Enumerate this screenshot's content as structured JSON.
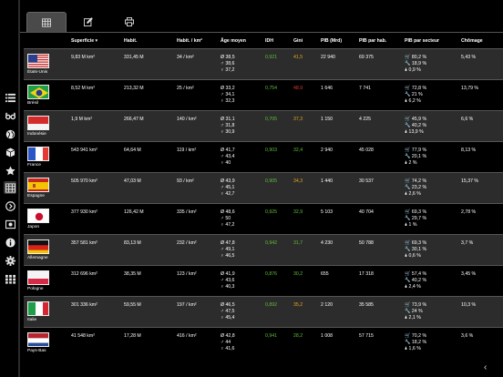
{
  "tabs": [
    {
      "name": "grid-tab",
      "icon": "table-icon",
      "active": true
    },
    {
      "name": "edit-tab",
      "icon": "edit-icon",
      "active": false
    },
    {
      "name": "print-tab",
      "icon": "print-icon",
      "active": false
    }
  ],
  "rail_icons": [
    "list-icon",
    "glasses-icon",
    "globe-icon",
    "cube-icon",
    "star-icon",
    "table-icon",
    "arrow-circle-icon",
    "image-icon",
    "info-icon",
    "gear-icon",
    "grid-icon"
  ],
  "headers": {
    "superficie": "Superficie",
    "habit": "Habit.",
    "habit_km2": "Habit. / km²",
    "age": "Âge moyen",
    "idh": "IDH",
    "gini": "Gini",
    "pib": "PIB (Mrd)",
    "pib_hab": "PIB par hab.",
    "pib_secteur": "PIB par secteur",
    "chomage": "Chômage"
  },
  "rows": [
    {
      "country": "États-Unis",
      "flag": "us",
      "superficie": "9,83 M km²",
      "habit": "331,45 M",
      "habit_km2": "34 / km²",
      "age": [
        "Ø 38,5",
        "♂ 38,6",
        "♀ 37,2"
      ],
      "idh": "0,921",
      "idh_color": "green",
      "gini": "41,5",
      "gini_color": "orange",
      "pib": "22 940",
      "pib_hab": "69 375",
      "secteur": [
        "🛒 80,2 %",
        "🔧 18,9 %",
        "🌢 0,9 %"
      ],
      "chomage": "5,43 %"
    },
    {
      "country": "Brésil",
      "flag": "br",
      "superficie": "8,52 M km²",
      "habit": "213,32 M",
      "habit_km2": "25 / km²",
      "age": [
        "Ø 33,2",
        "♂ 34,1",
        "♀ 32,3"
      ],
      "idh": "0,754",
      "idh_color": "green",
      "gini": "48,9",
      "gini_color": "red",
      "pib": "1 646",
      "pib_hab": "7 741",
      "secteur": [
        "🛒 72,8 %",
        "🔧 21 %",
        "🌢 6,2 %"
      ],
      "chomage": "13,79 %"
    },
    {
      "country": "Indonésie",
      "flag": "id",
      "superficie": "1,9 M km²",
      "habit": "266,47 M",
      "habit_km2": "140 / km²",
      "age": [
        "Ø 31,1",
        "♂ 31,8",
        "♀ 30,9"
      ],
      "idh": "0,705",
      "idh_color": "green",
      "gini": "37,3",
      "gini_color": "orange",
      "pib": "1 150",
      "pib_hab": "4 225",
      "secteur": [
        "🛒 45,9 %",
        "🔧 40,2 %",
        "🌢 13,9 %"
      ],
      "chomage": "6,6 %"
    },
    {
      "country": "France",
      "flag": "fr",
      "superficie": "543 941 km²",
      "habit": "64,64 M",
      "habit_km2": "119 / km²",
      "age": [
        "Ø 41,7",
        "♂ 43,4",
        "♀ 40"
      ],
      "idh": "0,903",
      "idh_color": "green",
      "gini": "32,4",
      "gini_color": "green",
      "pib": "2 940",
      "pib_hab": "45 028",
      "secteur": [
        "🛒 77,9 %",
        "🔧 20,1 %",
        "🌢 2 %"
      ],
      "chomage": "8,13 %"
    },
    {
      "country": "Espagne",
      "flag": "es",
      "superficie": "505 970 km²",
      "habit": "47,03 M",
      "habit_km2": "93 / km²",
      "age": [
        "Ø 43,9",
        "♂ 45,1",
        "♀ 42,7"
      ],
      "idh": "0,905",
      "idh_color": "green",
      "gini": "34,3",
      "gini_color": "orange",
      "pib": "1 440",
      "pib_hab": "30 537",
      "secteur": [
        "🛒 74,2 %",
        "🔧 23,2 %",
        "🌢 2,6 %"
      ],
      "chomage": "15,37 %"
    },
    {
      "country": "Japon",
      "flag": "jp",
      "superficie": "377 930 km²",
      "habit": "126,42 M",
      "habit_km2": "335 / km²",
      "age": [
        "Ø 48,6",
        "♂ 50",
        "♀ 47,2"
      ],
      "idh": "0,925",
      "idh_color": "green",
      "gini": "32,9",
      "gini_color": "green",
      "pib": "5 103",
      "pib_hab": "40 704",
      "secteur": [
        "🛒 69,3 %",
        "🔧 29,7 %",
        "🌢 1 %"
      ],
      "chomage": "2,78 %"
    },
    {
      "country": "Allemagne",
      "flag": "de",
      "superficie": "357 581 km²",
      "habit": "83,13 M",
      "habit_km2": "232 / km²",
      "age": [
        "Ø 47,8",
        "♂ 49,1",
        "♀ 46,5"
      ],
      "idh": "0,942",
      "idh_color": "green",
      "gini": "31,7",
      "gini_color": "green",
      "pib": "4 230",
      "pib_hab": "50 788",
      "secteur": [
        "🛒 69,3 %",
        "🔧 30,1 %",
        "🌢 0,6 %"
      ],
      "chomage": "3,7 %"
    },
    {
      "country": "Pologne",
      "flag": "pl",
      "superficie": "312 696 km²",
      "habit": "38,35 M",
      "habit_km2": "123 / km²",
      "age": [
        "Ø 41,9",
        "♂ 43,6",
        "♀ 40,3"
      ],
      "idh": "0,876",
      "idh_color": "green",
      "gini": "30,2",
      "gini_color": "green",
      "pib": "655",
      "pib_hab": "17 318",
      "secteur": [
        "🛒 57,4 %",
        "🔧 40,2 %",
        "🌢 2,4 %"
      ],
      "chomage": "3,45 %"
    },
    {
      "country": "Italie",
      "flag": "it",
      "superficie": "301 336 km²",
      "habit": "59,55 M",
      "habit_km2": "197 / km²",
      "age": [
        "Ø 46,5",
        "♂ 47,5",
        "♀ 45,4"
      ],
      "idh": "0,892",
      "idh_color": "green",
      "gini": "35,2",
      "gini_color": "orange",
      "pib": "2 120",
      "pib_hab": "35 585",
      "secteur": [
        "🛒 73,9 %",
        "🔧 24 %",
        "🌢 2,1 %"
      ],
      "chomage": "10,3 %"
    },
    {
      "country": "Pays-Bas",
      "flag": "nl",
      "superficie": "41 548 km²",
      "habit": "17,28 M",
      "habit_km2": "416 / km²",
      "age": [
        "Ø 42,8",
        "♂ 44",
        "♀ 41,6"
      ],
      "idh": "0,941",
      "idh_color": "green",
      "gini": "28,2",
      "gini_color": "green",
      "pib": "1 008",
      "pib_hab": "57 715",
      "secteur": [
        "🛒 70,2 %",
        "🔧 18,2 %",
        "🌢 1,6 %"
      ],
      "chomage": "3,6 %"
    }
  ]
}
